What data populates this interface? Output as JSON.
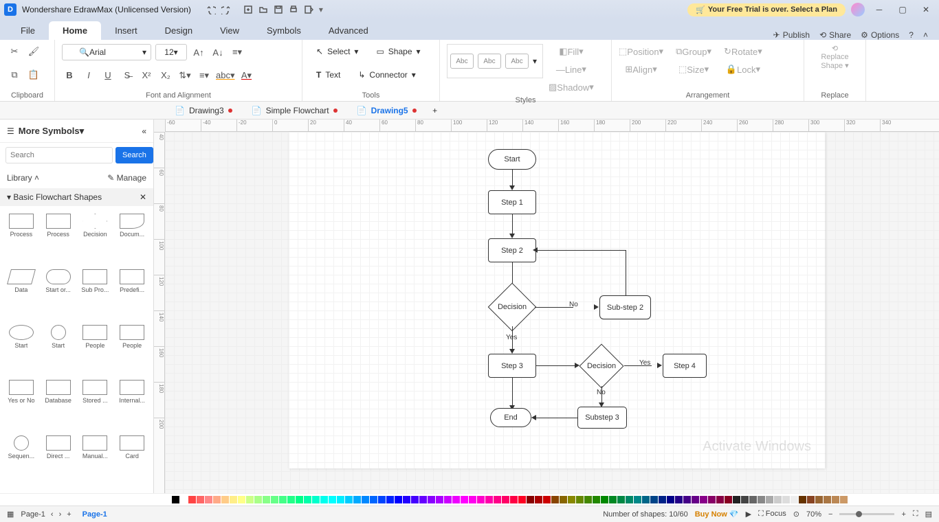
{
  "title": "Wondershare EdrawMax (Unlicensed Version)",
  "trial": "Your Free Trial is over. Select a Plan",
  "menus": [
    "File",
    "Home",
    "Insert",
    "Design",
    "View",
    "Symbols",
    "Advanced"
  ],
  "menu_right": {
    "publish": "Publish",
    "share": "Share",
    "options": "Options"
  },
  "font": {
    "name": "Arial",
    "size": "12"
  },
  "ribbon": {
    "clipboard": "Clipboard",
    "font_align": "Font and Alignment",
    "tools": "Tools",
    "styles": "Styles",
    "arrangement": "Arrangement",
    "replace": "Replace",
    "select": "Select",
    "shape": "Shape",
    "text": "Text",
    "connector": "Connector",
    "fill": "Fill",
    "line": "Line",
    "shadow": "Shadow",
    "position": "Position",
    "align": "Align",
    "group": "Group",
    "size": "Size",
    "rotate": "Rotate",
    "lock": "Lock",
    "replace_shape": "Replace\nShape",
    "abc": "Abc"
  },
  "doctabs": [
    {
      "name": "Drawing3",
      "dirty": true
    },
    {
      "name": "Simple Flowchart",
      "dirty": true
    },
    {
      "name": "Drawing5",
      "dirty": true,
      "active": true
    }
  ],
  "sidebar": {
    "more": "More Symbols",
    "search_ph": "Search",
    "search_btn": "Search",
    "library": "Library",
    "manage": "Manage",
    "section": "Basic Flowchart Shapes",
    "shapes": [
      "Process",
      "Process",
      "Decision",
      "Docum...",
      "Data",
      "Start or...",
      "Sub Pro...",
      "Predefi...",
      "Start",
      "Start",
      "People",
      "People",
      "Yes or No",
      "Database",
      "Stored ...",
      "Internal...",
      "Sequen...",
      "Direct ...",
      "Manual...",
      "Card"
    ]
  },
  "ruler_h": [
    "-60",
    "-40",
    "-20",
    "0",
    "20",
    "40",
    "60",
    "80",
    "100",
    "120",
    "140",
    "160",
    "180",
    "200",
    "220",
    "240",
    "260",
    "280",
    "300",
    "320",
    "340"
  ],
  "ruler_v": [
    "40",
    "60",
    "80",
    "100",
    "120",
    "140",
    "160",
    "180",
    "200"
  ],
  "flowchart": {
    "start": "Start",
    "step1": "Step 1",
    "step2": "Step 2",
    "decision": "Decision",
    "substep2": "Sub-step 2",
    "yes": "Yes",
    "no": "No",
    "step3": "Step 3",
    "decision2": "Decision",
    "step4": "Step 4",
    "substep3": "Substep 3",
    "end": "End"
  },
  "watermark": "Activate Windows",
  "status": {
    "page": "Page-1",
    "page_tab": "Page-1",
    "shapes": "Number of shapes: 10/60",
    "buy": "Buy Now",
    "focus": "Focus",
    "zoom": "70%"
  },
  "colors": [
    "#000",
    "#fff",
    "#f44",
    "#f66",
    "#f88",
    "#fa8",
    "#fc8",
    "#fe8",
    "#ff8",
    "#cf8",
    "#af8",
    "#8f8",
    "#6f8",
    "#4f8",
    "#2f8",
    "#0f8",
    "#0fa",
    "#0fc",
    "#0fe",
    "#0ff",
    "#0ef",
    "#0cf",
    "#0af",
    "#08f",
    "#06f",
    "#04f",
    "#02f",
    "#00f",
    "#20f",
    "#40f",
    "#60f",
    "#80f",
    "#a0f",
    "#c0f",
    "#e0f",
    "#f0f",
    "#f0e",
    "#f0c",
    "#f0a",
    "#f08",
    "#f06",
    "#f04",
    "#f02",
    "#800",
    "#a00",
    "#c00",
    "#840",
    "#860",
    "#880",
    "#680",
    "#480",
    "#280",
    "#080",
    "#082",
    "#084",
    "#086",
    "#088",
    "#068",
    "#048",
    "#028",
    "#008",
    "#208",
    "#408",
    "#608",
    "#808",
    "#806",
    "#804",
    "#802",
    "#222",
    "#444",
    "#666",
    "#888",
    "#aaa",
    "#ccc",
    "#ddd",
    "#eee",
    "#630",
    "#842",
    "#963",
    "#a74",
    "#b85",
    "#c96"
  ]
}
